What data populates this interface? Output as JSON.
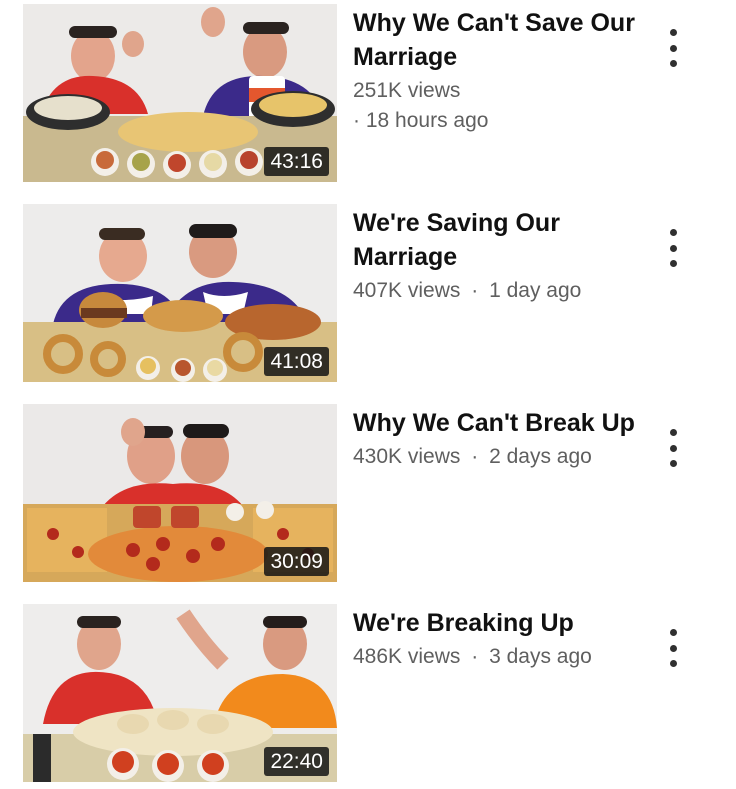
{
  "videos": [
    {
      "title": "Why We Can't Save Our Marriage",
      "views": "251K views",
      "separator": "·",
      "age": "18 hours ago",
      "duration": "43:16"
    },
    {
      "title": "We're Saving Our Marriage",
      "views": "407K views",
      "separator": "·",
      "age": "1 day ago",
      "duration": "41:08"
    },
    {
      "title": "Why We Can't Break Up",
      "views": "430K views",
      "separator": "·",
      "age": "2 days ago",
      "duration": "30:09"
    },
    {
      "title": "We're Breaking Up",
      "views": "486K views",
      "separator": "·",
      "age": "3 days ago",
      "duration": "22:40"
    }
  ],
  "icons": {
    "more": "more-vert-icon"
  },
  "colors": {
    "red_shirt": "#d9302b",
    "purple_shirt": "#3b2a8a",
    "orange_shirt": "#f28a1c",
    "duration_bg": "#141414"
  }
}
